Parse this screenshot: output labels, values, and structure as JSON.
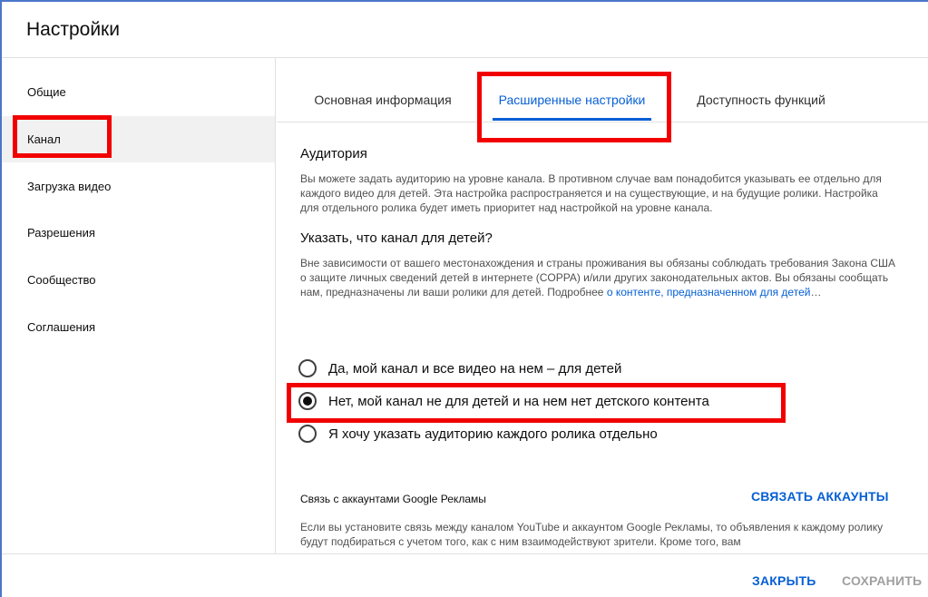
{
  "header": {
    "title": "Настройки"
  },
  "sidebar": {
    "items": [
      {
        "label": "Общие",
        "active": false
      },
      {
        "label": "Канал",
        "active": true
      },
      {
        "label": "Загрузка видео",
        "active": false
      },
      {
        "label": "Разрешения",
        "active": false
      },
      {
        "label": "Сообщество",
        "active": false
      },
      {
        "label": "Соглашения",
        "active": false
      }
    ]
  },
  "tabs": [
    {
      "label": "Основная информация",
      "active": false
    },
    {
      "label": "Расширенные настройки",
      "active": true
    },
    {
      "label": "Доступность функций",
      "active": false
    }
  ],
  "audience": {
    "heading": "Аудитория",
    "description": "Вы можете задать аудиторию на уровне канала. В противном случае вам понадобится указывать ее отдельно для каждого видео для детей. Эта настройка распространяется и на существующие, и на будущие ролики. Настройка для отдельного ролика будет иметь приоритет над настройкой на уровне канала.",
    "question": "Указать, что канал для детей?",
    "legal_text": "Вне зависимости от вашего местонахождения и страны проживания вы обязаны соблюдать требования Закона США о защите личных сведений детей в интернете (COPPA) и/или других законодательных актов. Вы обязаны сообщать нам, предназначены ли ваши ролики для детей. Подробнее ",
    "legal_link": "о контенте, предназначенном для детей",
    "legal_suffix": "…",
    "options": [
      {
        "label": "Да, мой канал и все видео на нем – для детей",
        "selected": false
      },
      {
        "label": "Нет, мой канал не для детей и на нем нет детского контента",
        "selected": true
      },
      {
        "label": "Я хочу указать аудиторию каждого ролика отдельно",
        "selected": false
      }
    ]
  },
  "ads": {
    "title": "Связь с аккаунтами Google Рекламы",
    "link_label": "СВЯЗАТЬ АККАУНТЫ",
    "description": "Если вы установите связь между каналом YouTube и аккаунтом Google Рекламы, то объявления к каждому ролику будут подбираться с учетом того, как с ним взаимодействуют зрители. Кроме того, вам"
  },
  "footer": {
    "close_label": "ЗАКРЫТЬ",
    "save_label": "СОХРАНИТЬ"
  },
  "colors": {
    "accent": "#065fd4",
    "highlight": "#f20000",
    "active_bg": "#f1f1f1"
  }
}
